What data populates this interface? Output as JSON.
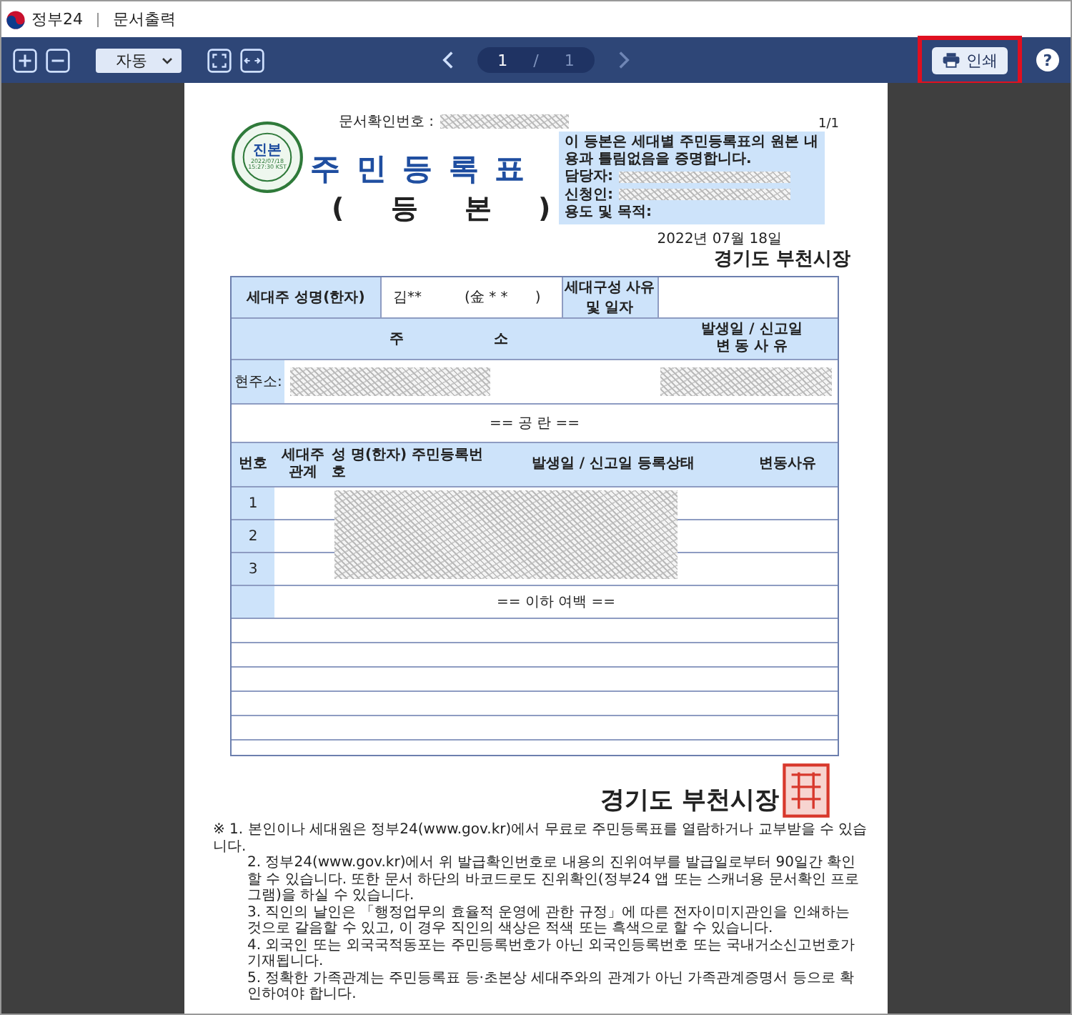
{
  "app": {
    "title": "정부24",
    "section": "문서출력"
  },
  "toolbar": {
    "zoom": "자동",
    "page_current": "1",
    "page_separator": "/",
    "page_total": "1",
    "print": "인쇄",
    "help": "?"
  },
  "document": {
    "confirm_label": "문서확인번호 :",
    "page_count": "1/1",
    "stamp": {
      "main": "진본",
      "date": "2022/07/18",
      "time": "15:27:30",
      "zone": "KST"
    },
    "title": "주 민 등 록 표",
    "subtitle": "( 등 본 )",
    "notice": "이 등본은 세대별 주민등록표의 원본 내용과 틀림없음을 증명합니다.",
    "notice_fields": [
      "담당자:",
      "신청인:",
      "용도 및 목적:"
    ],
    "date": "2022년 07월 18일",
    "issuer": "경기도 부천시장",
    "head_label": "세대주 성명(한자)",
    "head_name": "김**",
    "head_hanja": "(金 * *      )",
    "composition_label": "세대구성 사유 및 일자",
    "address_header": "주 소",
    "address_date_header": "발생일 / 신고일",
    "address_reason_header": "변 동 사 유",
    "address_label": "현주소:",
    "blank_mark": "== 공 란 ==",
    "member_columns": [
      "번호",
      "세대주 관계",
      "성 명(한자) 주민등록번호",
      "발생일 / 신고일 등록상태",
      "변동사유"
    ],
    "members": [
      {
        "number": "1"
      },
      {
        "number": "2"
      },
      {
        "number": "3"
      }
    ],
    "end_mark": "== 이하 여백 ==",
    "issuer_bottom": "경기도 부천시장",
    "footnotes": [
      "※ 1. 본인이나 세대원은 정부24(www.gov.kr)에서 무료로 주민등록표를 열람하거나 교부받을 수 있습니다.",
      "2. 정부24(www.gov.kr)에서 위 발급확인번호로 내용의 진위여부를 발급일로부터 90일간 확인할 수 있습니다. 또한 문서 하단의 바코드로도 진위확인(정부24 앱 또는 스캐너용 문서확인 프로그램)을 하실 수 있습니다.",
      "3. 직인의 날인은 「행정업무의 효율적 운영에 관한 규정」에 따른 전자이미지관인을 인쇄하는 것으로 갈음할 수 있고, 이 경우 직인의 색상은 적색 또는 흑색으로 할 수 있습니다.",
      "4. 외국인 또는 외국국적동포는 주민등록번호가 아닌 외국인등록번호 또는 국내거소신고번호가 기재됩니다.",
      "5. 정확한 가족관계는 주민등록표 등·초본상 세대주와의 관계가 아닌 가족관계증명서 등으로 확인하여야 합니다."
    ]
  }
}
